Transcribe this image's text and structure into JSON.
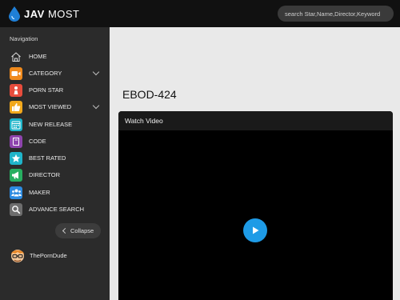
{
  "brand": {
    "bold": "JAV",
    "rest": " MOST"
  },
  "search": {
    "placeholder": "search Star,Name,Director,Keyword"
  },
  "sidebar": {
    "heading": "Navigation",
    "items": [
      {
        "label": "HOME",
        "icon": "home-icon",
        "color": "#2b2b2b",
        "chevron": false
      },
      {
        "label": "CATEGORY",
        "icon": "video-camera-icon",
        "color": "#f08a1c",
        "chevron": true
      },
      {
        "label": "PORN STAR",
        "icon": "person-icon",
        "color": "#e74c3c",
        "chevron": false
      },
      {
        "label": "MOST VIEWED",
        "icon": "thumbs-up-icon",
        "color": "#f1a81c",
        "chevron": true
      },
      {
        "label": "NEW RELEASE",
        "icon": "calendar-icon",
        "color": "#1fb4c9",
        "chevron": false
      },
      {
        "label": "CODE",
        "icon": "book-icon",
        "color": "#8e44ad",
        "chevron": false
      },
      {
        "label": "BEST RATED",
        "icon": "star-icon",
        "color": "#1fb4c9",
        "chevron": false
      },
      {
        "label": "DIRECTOR",
        "icon": "megaphone-icon",
        "color": "#27ae60",
        "chevron": false
      },
      {
        "label": "MAKER",
        "icon": "group-icon",
        "color": "#2d8be0",
        "chevron": false
      },
      {
        "label": "ADVANCE SEARCH",
        "icon": "search-icon",
        "color": "#6d6d6d",
        "chevron": false
      }
    ],
    "collapse_label": "Collapse",
    "partner_label": "ThePornDude"
  },
  "main": {
    "title": "EBOD-424",
    "player_heading": "Watch Video"
  },
  "colors": {
    "accent": "#1e9be6",
    "topbar": "#111111",
    "sidebar": "#2b2b2b"
  }
}
